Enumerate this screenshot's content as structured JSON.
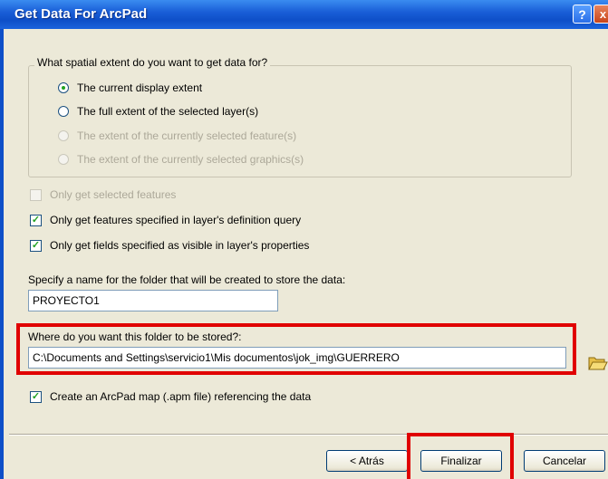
{
  "window": {
    "title": "Get Data For ArcPad",
    "help_label": "?",
    "close_label": "x"
  },
  "extent_group": {
    "legend": "What spatial extent do you want to get data for?",
    "options": [
      {
        "label": "The current display extent",
        "selected": true,
        "enabled": true
      },
      {
        "label": "The full extent of the selected layer(s)",
        "selected": false,
        "enabled": true
      },
      {
        "label": "The extent of the currently selected feature(s)",
        "selected": false,
        "enabled": false
      },
      {
        "label": "The extent of the currently selected graphics(s)",
        "selected": false,
        "enabled": false
      }
    ]
  },
  "checkboxes": [
    {
      "label": "Only get selected features",
      "checked": false,
      "enabled": false
    },
    {
      "label": "Only get features specified in layer's definition query",
      "checked": true,
      "enabled": true
    },
    {
      "label": "Only get fields specified as visible in layer's properties",
      "checked": true,
      "enabled": true
    }
  ],
  "folder_name": {
    "label": "Specify a name for the folder that will be created to store the data:",
    "value": "PROYECTO1"
  },
  "folder_location": {
    "label": "Where do you want this folder to be stored?:",
    "value": "C:\\Documents and Settings\\servicio1\\Mis documentos\\jok_img\\GUERRERO"
  },
  "create_map": {
    "label": "Create an ArcPad map (.apm file) referencing the data",
    "checked": true
  },
  "buttons": {
    "back": "< Atrás",
    "finish": "Finalizar",
    "cancel": "Cancelar"
  },
  "colors": {
    "highlight": "#e00000",
    "titlebar": "#0e4fc8"
  },
  "icons": {
    "browse": "open-folder-icon"
  }
}
